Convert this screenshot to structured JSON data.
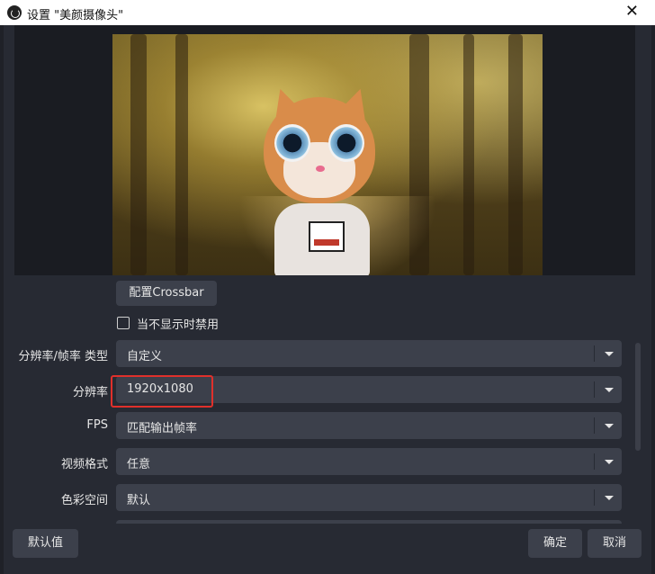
{
  "window": {
    "title": "设置 \"美颜摄像头\"",
    "close_glyph": "✕"
  },
  "controls": {
    "crossbar_button": "配置Crossbar",
    "disable_when_hidden": {
      "label": "当不显示时禁用",
      "checked": false
    }
  },
  "settings": [
    {
      "label": "分辨率/帧率 类型",
      "value": "自定义"
    },
    {
      "label": "分辨率",
      "value": "1920x1080"
    },
    {
      "label": "FPS",
      "value": "匹配输出帧率"
    },
    {
      "label": "视频格式",
      "value": "任意"
    },
    {
      "label": "色彩空间",
      "value": "默认"
    }
  ],
  "footer": {
    "defaults": "默认值",
    "ok": "确定",
    "cancel": "取消"
  },
  "colors": {
    "highlight": "#e0302b",
    "button_bg": "#3c404b",
    "dialog_bg": "#272a33"
  }
}
